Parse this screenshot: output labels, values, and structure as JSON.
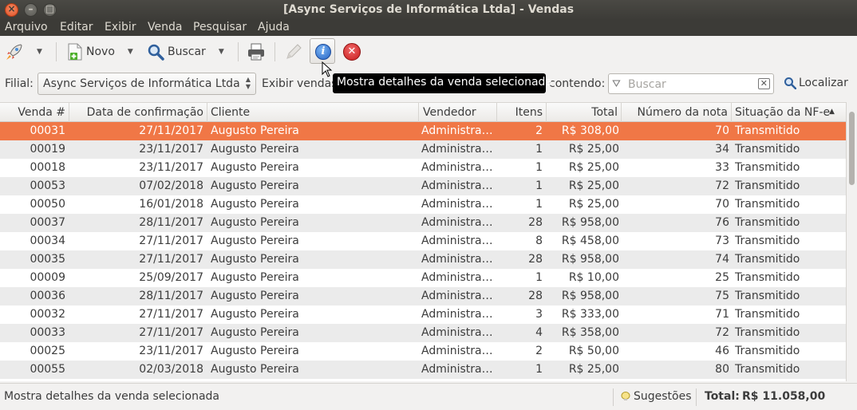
{
  "window": {
    "title": "[Async Serviços de Informática Ltda] - Vendas"
  },
  "menu": [
    "Arquivo",
    "Editar",
    "Exibir",
    "Venda",
    "Pesquisar",
    "Ajuda"
  ],
  "toolbar": {
    "new_label": "Novo",
    "search_label": "Buscar",
    "tooltip": "Mostra detalhes da venda selecionada"
  },
  "filter": {
    "branch_label": "Filial:",
    "branch_value": "Async Serviços de Informática Ltda",
    "show_label": "Exibir vendas",
    "contains_label": "contendo:",
    "search_placeholder": "Buscar",
    "find_label": "Localizar"
  },
  "table": {
    "columns": [
      "Venda #",
      "Data de confirmação",
      "Cliente",
      "Vendedor",
      "Itens",
      "Total",
      "Número da nota",
      "Situação da NF-e"
    ],
    "sort_indicator": "▲",
    "rows": [
      [
        "00031",
        "27/11/2017",
        "Augusto Pereira",
        "Administra…",
        "2",
        "R$ 308,00",
        "70",
        "Transmitido"
      ],
      [
        "00019",
        "23/11/2017",
        "Augusto Pereira",
        "Administra…",
        "1",
        "R$ 25,00",
        "34",
        "Transmitido"
      ],
      [
        "00018",
        "23/11/2017",
        "Augusto Pereira",
        "Administra…",
        "1",
        "R$ 25,00",
        "33",
        "Transmitido"
      ],
      [
        "00053",
        "07/02/2018",
        "Augusto Pereira",
        "Administra…",
        "1",
        "R$ 25,00",
        "72",
        "Transmitido"
      ],
      [
        "00050",
        "16/01/2018",
        "Augusto Pereira",
        "Administra…",
        "1",
        "R$ 25,00",
        "70",
        "Transmitido"
      ],
      [
        "00037",
        "28/11/2017",
        "Augusto Pereira",
        "Administra…",
        "28",
        "R$ 958,00",
        "76",
        "Transmitido"
      ],
      [
        "00034",
        "27/11/2017",
        "Augusto Pereira",
        "Administra…",
        "8",
        "R$ 458,00",
        "73",
        "Transmitido"
      ],
      [
        "00035",
        "27/11/2017",
        "Augusto Pereira",
        "Administra…",
        "28",
        "R$ 958,00",
        "74",
        "Transmitido"
      ],
      [
        "00009",
        "25/09/2017",
        "Augusto Pereira",
        "Administra…",
        "1",
        "R$ 10,00",
        "25",
        "Transmitido"
      ],
      [
        "00036",
        "28/11/2017",
        "Augusto Pereira",
        "Administra…",
        "28",
        "R$ 958,00",
        "75",
        "Transmitido"
      ],
      [
        "00032",
        "27/11/2017",
        "Augusto Pereira",
        "Administra…",
        "3",
        "R$ 333,00",
        "71",
        "Transmitido"
      ],
      [
        "00033",
        "27/11/2017",
        "Augusto Pereira",
        "Administra…",
        "4",
        "R$ 358,00",
        "72",
        "Transmitido"
      ],
      [
        "00025",
        "23/11/2017",
        "Augusto Pereira",
        "Administra…",
        "2",
        "R$ 50,00",
        "46",
        "Transmitido"
      ],
      [
        "00055",
        "02/03/2018",
        "Augusto Pereira",
        "Administra…",
        "1",
        "R$ 25,00",
        "80",
        "Transmitido"
      ]
    ]
  },
  "status": {
    "message": "Mostra detalhes da venda selecionada",
    "suggestions_label": "Sugestões",
    "total_label": "Total:",
    "total_value": "R$ 11.058,00"
  },
  "colors": {
    "selected_row": "#f07746",
    "title_bar": "#3c3b37",
    "alt_row": "#ebebeb"
  },
  "icons": [
    "rocket-icon",
    "new-document-icon",
    "magnifier-icon",
    "printer-icon",
    "edit-pencil-icon",
    "info-icon",
    "cancel-icon",
    "funnel-icon",
    "clear-icon",
    "lightbulb-icon"
  ]
}
